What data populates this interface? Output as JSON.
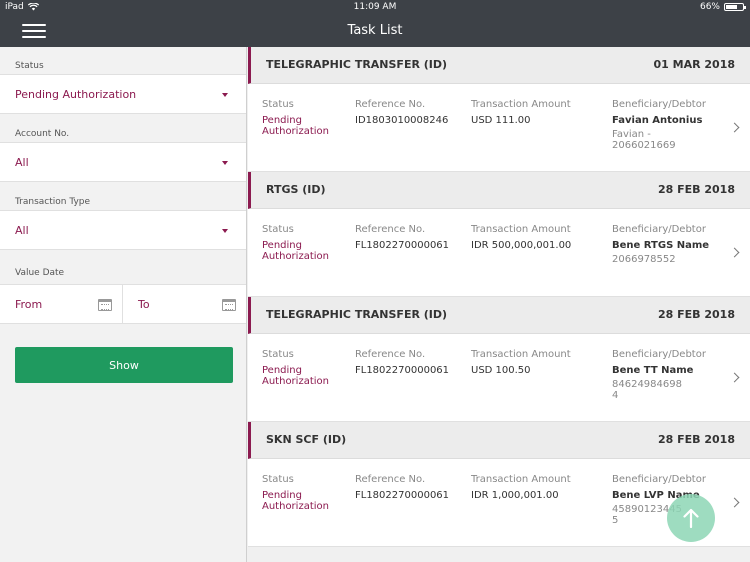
{
  "status_bar": {
    "device": "iPad",
    "time": "11:09 AM",
    "battery": "66%",
    "battery_level": 0.66
  },
  "header": {
    "title": "Task List",
    "menu_icon": "hamburger-menu-icon"
  },
  "filters": {
    "status": {
      "label": "Status",
      "value": "Pending Authorization"
    },
    "account": {
      "label": "Account No.",
      "value": "All"
    },
    "transaction_type": {
      "label": "Transaction Type",
      "value": "All"
    },
    "value_date": {
      "label": "Value Date",
      "from": "From",
      "to": "To"
    },
    "show_label": "Show"
  },
  "columns": {
    "status": "Status",
    "reference": "Reference No.",
    "amount": "Transaction Amount",
    "beneficiary": "Beneficiary/Debtor"
  },
  "tasks": [
    {
      "type": "TELEGRAPHIC TRANSFER (ID)",
      "date": "01 MAR 2018",
      "status": "Pending\nAuthorization",
      "reference": "ID1803010008246",
      "amount": "USD 111.00",
      "beneficiary_name": "Favian Antonius",
      "beneficiary_account": "Favian -\n2066021669"
    },
    {
      "type": "RTGS (ID)",
      "date": "28 FEB 2018",
      "status": "Pending\nAuthorization",
      "reference": "FL1802270000061",
      "amount": "IDR 500,000,001.00",
      "beneficiary_name": "Bene RTGS Name",
      "beneficiary_account": "2066978552"
    },
    {
      "type": "TELEGRAPHIC TRANSFER (ID)",
      "date": "28 FEB 2018",
      "status": "Pending\nAuthorization",
      "reference": "FL1802270000061",
      "amount": "USD 100.50",
      "beneficiary_name": "Bene TT Name",
      "beneficiary_account": "84624984698\n4"
    },
    {
      "type": "SKN SCF (ID)",
      "date": "28 FEB 2018",
      "status": "Pending\nAuthorization",
      "reference": "FL1802270000061",
      "amount": "IDR 1,000,001.00",
      "beneficiary_name": "Bene LVP Name",
      "beneficiary_account": "45890123445\n5"
    }
  ],
  "colors": {
    "header_bg": "#3d4147",
    "accent": "#8b1a4f",
    "show_button": "#1f9a5f",
    "fab": "#8dd6b5"
  }
}
